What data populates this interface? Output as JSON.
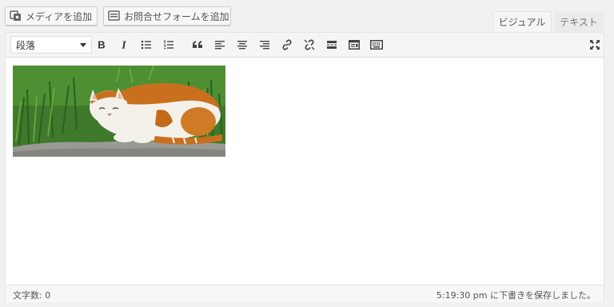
{
  "header": {
    "add_media_label": "メディアを追加",
    "add_form_label": "お問合せフォームを追加",
    "tabs": [
      {
        "label": "ビジュアル",
        "active": true
      },
      {
        "label": "テキスト",
        "active": false
      }
    ]
  },
  "toolbar": {
    "format_select": {
      "value": "段落"
    },
    "buttons": [
      "bold-icon",
      "italic-icon",
      "bullet-list-icon",
      "numbered-list-icon",
      "blockquote-icon",
      "align-left-icon",
      "align-center-icon",
      "align-right-icon",
      "link-icon",
      "unlink-icon",
      "read-more-icon",
      "toolbar-toggle-icon",
      "keyboard-icon",
      "fullscreen-icon"
    ]
  },
  "content": {
    "image": {
      "subject": "calico cat lying on stone in grass"
    }
  },
  "status": {
    "word_count": "文字数: 0",
    "draft_saved": "5:19:30 pm に下書きを保存しました。"
  },
  "colors": {
    "background": "#f1f1f1",
    "toolbar": "#f5f5f5",
    "editor": "#ffffff",
    "border": "#dddddd"
  }
}
